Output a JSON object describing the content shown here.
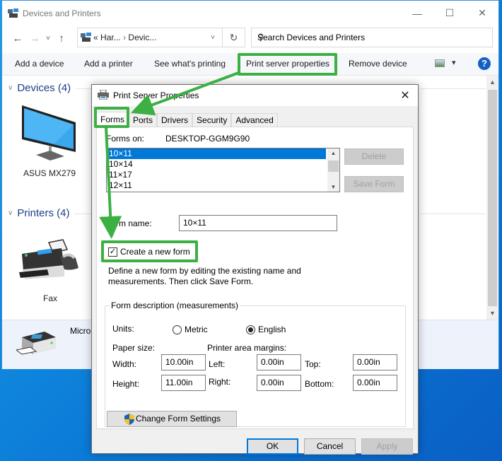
{
  "window": {
    "title": "Devices and Printers",
    "controls": {
      "minimize": "—",
      "maximize": "☐",
      "close": "✕"
    }
  },
  "nav": {
    "back": "←",
    "forward": "→",
    "recent": "˅",
    "up": "↑",
    "address_prefix": "«",
    "address_segments": [
      "Har...",
      "›",
      "Devic..."
    ],
    "address_dropdown": "˅",
    "refresh": "↻",
    "search_placeholder": "Search Devices and Printers",
    "search_icon": "⚲"
  },
  "commands": {
    "add_device": "Add a device",
    "add_printer": "Add a printer",
    "see_printing": "See what's printing",
    "print_server_props": "Print server properties",
    "remove_device": "Remove device",
    "view_dropdown": "▾",
    "help": "?"
  },
  "groups": {
    "devices": {
      "label": "Devices (4)",
      "items": [
        {
          "label": "ASUS MX279"
        }
      ]
    },
    "printers": {
      "label": "Printers (4)",
      "items": [
        {
          "label": "Fax"
        },
        {
          "label": "Micro"
        }
      ]
    }
  },
  "dialog": {
    "title": "Print Server Properties",
    "close": "✕",
    "tabs": [
      "Forms",
      "Ports",
      "Drivers",
      "Security",
      "Advanced"
    ],
    "active_tab": "Forms",
    "forms_on_label": "Forms on:",
    "forms_on_value": "DESKTOP-GGM9G90",
    "forms_list": [
      "10×11",
      "10×14",
      "11×17",
      "12×11"
    ],
    "selected_form": "10×11",
    "delete_button": "Delete",
    "save_form_button": "Save Form",
    "form_name_label": "Form name:",
    "form_name_value": "10×11",
    "create_new_form_label": "Create a new form",
    "create_new_form_checked": true,
    "description": "Define a new form by editing the existing name and measurements. Then click Save Form.",
    "description_line1": "Define a new form by editing the existing name and",
    "description_line2": "measurements. Then click Save Form.",
    "measurements": {
      "legend": "Form description (measurements)",
      "units_label": "Units:",
      "metric_label": "Metric",
      "english_label": "English",
      "selected_unit": "English",
      "paper_size_label": "Paper size:",
      "margins_label": "Printer area margins:",
      "width_label": "Width:",
      "width_value": "10.00in",
      "height_label": "Height:",
      "height_value": "11.00in",
      "left_label": "Left:",
      "left_value": "0.00in",
      "right_label": "Right:",
      "right_value": "0.00in",
      "top_label": "Top:",
      "top_value": "0.00in",
      "bottom_label": "Bottom:",
      "bottom_value": "0.00in"
    },
    "change_settings_button": "Change Form Settings",
    "ok_button": "OK",
    "cancel_button": "Cancel",
    "apply_button": "Apply"
  },
  "colors": {
    "highlight": "#3cb043",
    "selection": "#0078d7",
    "group_header": "#1e3f8a"
  }
}
